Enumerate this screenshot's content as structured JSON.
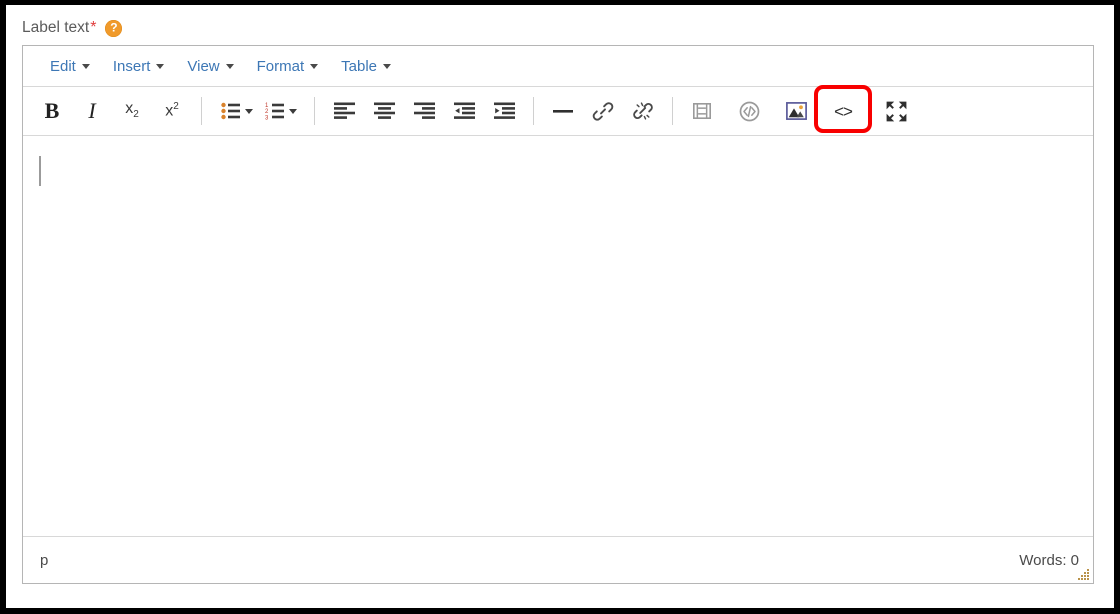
{
  "field": {
    "label": "Label text",
    "required_mark": "*",
    "help_icon_glyph": "?",
    "help_icon_name": "help-icon",
    "help_icon_color": "#f09a2b",
    "required_color": "#e03c3c"
  },
  "editor": {
    "menubar": [
      {
        "label": "Edit",
        "name": "menu-edit"
      },
      {
        "label": "Insert",
        "name": "menu-insert"
      },
      {
        "label": "View",
        "name": "menu-view"
      },
      {
        "label": "Format",
        "name": "menu-format"
      },
      {
        "label": "Table",
        "name": "menu-table"
      }
    ],
    "toolbar": [
      {
        "name": "bold-button",
        "title": "Bold",
        "glyph": "B",
        "kind": "text-bold",
        "disabled": false
      },
      {
        "name": "italic-button",
        "title": "Italic",
        "glyph": "I",
        "kind": "text-italic",
        "disabled": false
      },
      {
        "name": "subscript-button",
        "title": "Subscript",
        "glyph": "x",
        "sub": "2",
        "kind": "text-sub",
        "disabled": false
      },
      {
        "name": "superscript-button",
        "title": "Superscript",
        "glyph": "x",
        "sup": "2",
        "kind": "text-sup",
        "disabled": false
      },
      {
        "name": "bullet-list-button",
        "title": "Bullet list",
        "kind": "icon-bullet-list",
        "disabled": false,
        "has_caret": true
      },
      {
        "name": "numbered-list-button",
        "title": "Numbered list",
        "kind": "icon-numbered-list",
        "disabled": false,
        "has_caret": true
      },
      {
        "name": "align-left-button",
        "title": "Align left",
        "kind": "icon-align-left",
        "disabled": false
      },
      {
        "name": "align-center-button",
        "title": "Align center",
        "kind": "icon-align-center",
        "disabled": false
      },
      {
        "name": "align-right-button",
        "title": "Align right",
        "kind": "icon-align-right",
        "disabled": false
      },
      {
        "name": "decrease-indent-button",
        "title": "Decrease indent",
        "kind": "icon-outdent",
        "disabled": false
      },
      {
        "name": "increase-indent-button",
        "title": "Increase indent",
        "kind": "icon-indent",
        "disabled": false
      },
      {
        "name": "horizontal-rule-button",
        "title": "Horizontal line",
        "kind": "icon-hr",
        "disabled": false
      },
      {
        "name": "link-button",
        "title": "Insert link",
        "kind": "icon-link",
        "disabled": false
      },
      {
        "name": "unlink-button",
        "title": "Remove link",
        "kind": "icon-unlink",
        "disabled": false
      },
      {
        "name": "media-button",
        "title": "Insert media",
        "kind": "icon-media",
        "disabled": true
      },
      {
        "name": "embed-code-button",
        "title": "Insert embedded code",
        "kind": "icon-embed-circle",
        "disabled": true
      },
      {
        "name": "image-button",
        "title": "Insert image",
        "kind": "icon-image",
        "disabled": false
      },
      {
        "name": "source-code-button",
        "title": "Source code",
        "glyph": "<>",
        "kind": "text-code",
        "disabled": false,
        "highlighted": true
      },
      {
        "name": "fullscreen-button",
        "title": "Fullscreen",
        "kind": "icon-fullscreen",
        "disabled": false
      }
    ],
    "content": {
      "value": "",
      "caret_visible": true
    },
    "statusbar": {
      "element_path": "p",
      "word_count_label": "Words: 0"
    }
  },
  "highlight": {
    "target": "source-code-button",
    "color": "#f80000"
  }
}
